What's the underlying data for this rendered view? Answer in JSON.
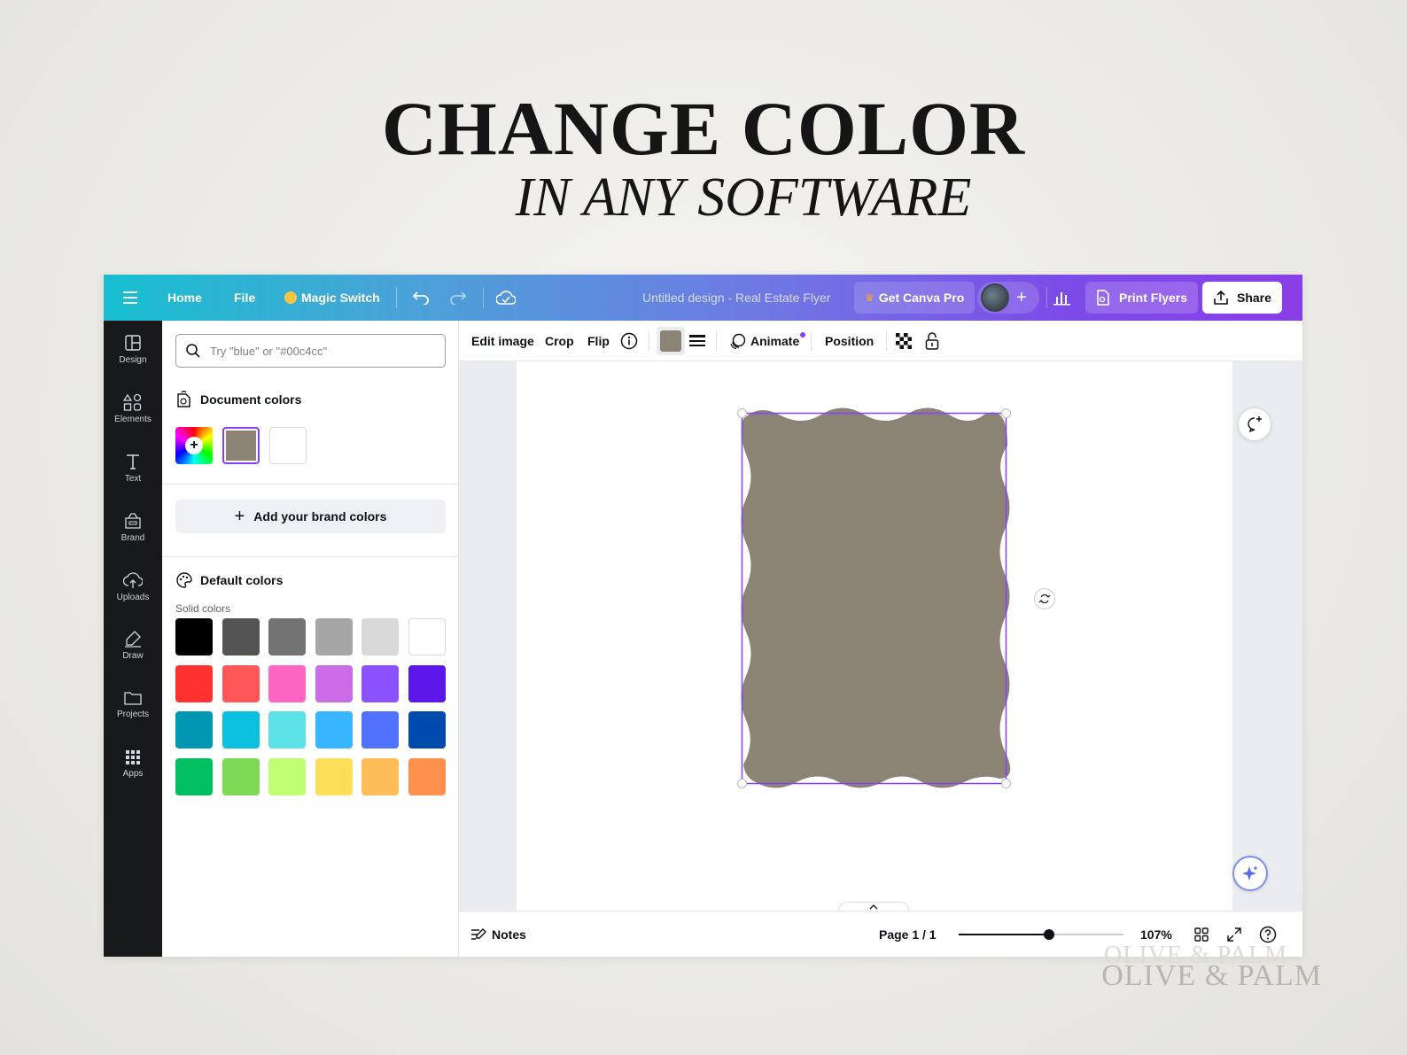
{
  "headline": {
    "title": "CHANGE COLOR",
    "subtitle": "IN ANY SOFTWARE"
  },
  "topbar": {
    "home": "Home",
    "file": "File",
    "magic_switch": "Magic Switch",
    "design_title": "Untitled design - Real Estate Flyer",
    "get_pro": "Get Canva Pro",
    "print": "Print Flyers",
    "share": "Share"
  },
  "rail": {
    "items": [
      {
        "label": "Design",
        "icon": "layout-icon"
      },
      {
        "label": "Elements",
        "icon": "shapes-icon"
      },
      {
        "label": "Text",
        "icon": "text-icon"
      },
      {
        "label": "Brand",
        "icon": "brand-icon"
      },
      {
        "label": "Uploads",
        "icon": "cloud-upload-icon"
      },
      {
        "label": "Draw",
        "icon": "pen-icon"
      },
      {
        "label": "Projects",
        "icon": "folder-icon"
      },
      {
        "label": "Apps",
        "icon": "apps-grid-icon"
      }
    ]
  },
  "panel": {
    "search_placeholder": "Try \"blue\" or \"#00c4cc\"",
    "document_colors": "Document colors",
    "doc_swatches": [
      "#8b8474",
      "#ffffff"
    ],
    "brand_button": "Add your brand colors",
    "default_colors": "Default colors",
    "solid_colors": "Solid colors",
    "palette": [
      [
        "#000000",
        "#545454",
        "#737373",
        "#a6a6a6",
        "#d9d9d9",
        "#ffffff"
      ],
      [
        "#ff3131",
        "#ff5757",
        "#ff66c4",
        "#cb6ce6",
        "#8c52ff",
        "#5e17eb"
      ],
      [
        "#0097b2",
        "#0cc0df",
        "#5ce1e6",
        "#38b6ff",
        "#5271ff",
        "#004aad"
      ],
      [
        "#00bf63",
        "#7ed957",
        "#c1ff72",
        "#ffde59",
        "#ffbd59",
        "#ff914d"
      ]
    ]
  },
  "ctxbar": {
    "edit_image": "Edit image",
    "crop": "Crop",
    "flip": "Flip",
    "fill_color": "#8b8474",
    "animate": "Animate",
    "position": "Position"
  },
  "canvas": {
    "shape_color": "#8b8474",
    "selection_color": "#8b3dff"
  },
  "bottombar": {
    "notes": "Notes",
    "page": "Page 1 / 1",
    "zoom": "107%",
    "zoom_fraction": 0.55
  },
  "watermark": "OLIVE & PALM",
  "colors": {
    "accent": "#8b3dff",
    "rail_bg": "#18191b"
  }
}
